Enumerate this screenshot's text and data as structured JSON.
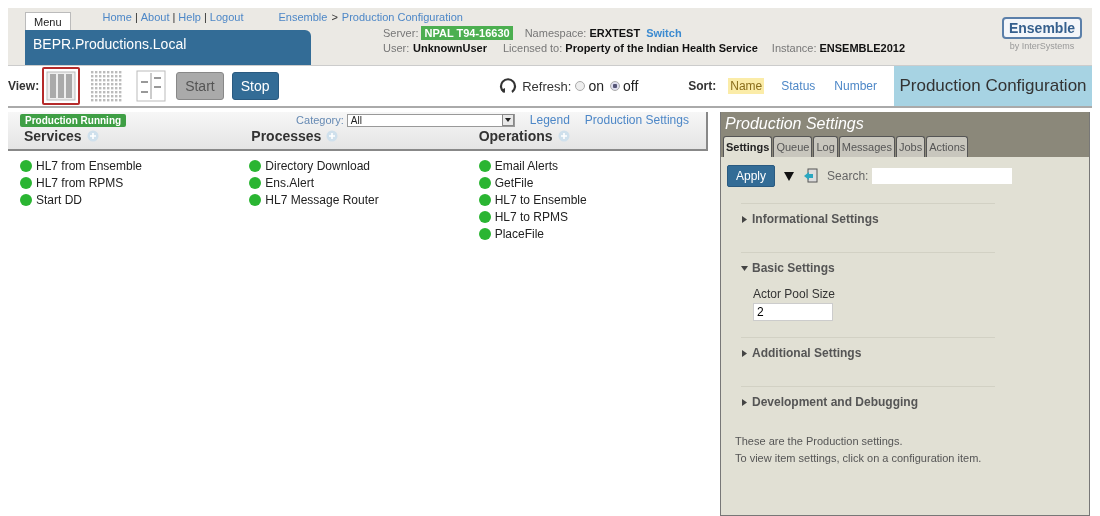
{
  "header": {
    "menu_tab": "Menu",
    "nav_links": [
      "Home",
      "About",
      "Help",
      "Logout"
    ],
    "nav_separator": "|",
    "breadcrumb": {
      "items": [
        "Ensemble",
        "Production Configuration"
      ],
      "separator": ">"
    },
    "production_name": "BEPR.Productions.Local",
    "server": {
      "label": "Server:",
      "value": "NPAL T94-16630"
    },
    "namespace": {
      "label": "Namespace:",
      "value": "ERXTEST",
      "link": "Switch"
    },
    "user": {
      "label": "User:",
      "value": "UnknownUser"
    },
    "licensed": {
      "label": "Licensed to:",
      "value": "Property of the Indian Health Service"
    },
    "instance": {
      "label": "Instance:",
      "value": "ENSEMBLE2012"
    },
    "logo": {
      "name": "Ensemble",
      "tagline": "by InterSystems"
    }
  },
  "toolbar": {
    "view_label": "View:",
    "views": [
      {
        "kind": "columns",
        "selected": true
      },
      {
        "kind": "grid",
        "selected": false
      },
      {
        "kind": "split",
        "selected": false
      }
    ],
    "buttons": [
      {
        "label": "Start",
        "disabled": true
      },
      {
        "label": "Stop",
        "disabled": false
      }
    ],
    "refresh": {
      "label": "Refresh:",
      "options": [
        {
          "label": "on",
          "selected": false
        },
        {
          "label": "off",
          "selected": true
        }
      ]
    },
    "sort": {
      "label": "Sort:",
      "options": [
        {
          "label": "Name",
          "selected": true
        },
        {
          "label": "Status",
          "selected": false
        },
        {
          "label": "Number",
          "selected": false
        }
      ]
    },
    "page_title": "Production Configuration"
  },
  "diagram": {
    "status_badge": "Production Running",
    "category": {
      "label": "Category:",
      "value": "All"
    },
    "links": [
      "Legend",
      "Production Settings"
    ],
    "columns": [
      {
        "title": "Services",
        "items": [
          "HL7 from Ensemble",
          "HL7 from RPMS",
          "Start DD"
        ]
      },
      {
        "title": "Processes",
        "items": [
          "Directory Download",
          "Ens.Alert",
          "HL7 Message Router"
        ]
      },
      {
        "title": "Operations",
        "items": [
          "Email Alerts",
          "GetFile",
          "HL7 to Ensemble",
          "HL7 to RPMS",
          "PlaceFile"
        ]
      }
    ]
  },
  "settings_panel": {
    "title": "Production Settings",
    "tabs": [
      {
        "label": "Settings",
        "selected": true
      },
      {
        "label": "Queue",
        "selected": false
      },
      {
        "label": "Log",
        "selected": false
      },
      {
        "label": "Messages",
        "selected": false
      },
      {
        "label": "Jobs",
        "selected": false
      },
      {
        "label": "Actions",
        "selected": false
      }
    ],
    "apply": "Apply",
    "search": {
      "label": "Search:"
    },
    "sections": [
      {
        "label": "Informational Settings",
        "expanded": false
      },
      {
        "label": "Basic Settings",
        "expanded": true,
        "fields": [
          {
            "label": "Actor Pool Size",
            "value": "2"
          }
        ]
      },
      {
        "label": "Additional Settings",
        "expanded": false
      },
      {
        "label": "Development and Debugging",
        "expanded": false
      }
    ],
    "notes": [
      "These are the Production settings.",
      "To view item settings, click on a configuration item."
    ]
  }
}
